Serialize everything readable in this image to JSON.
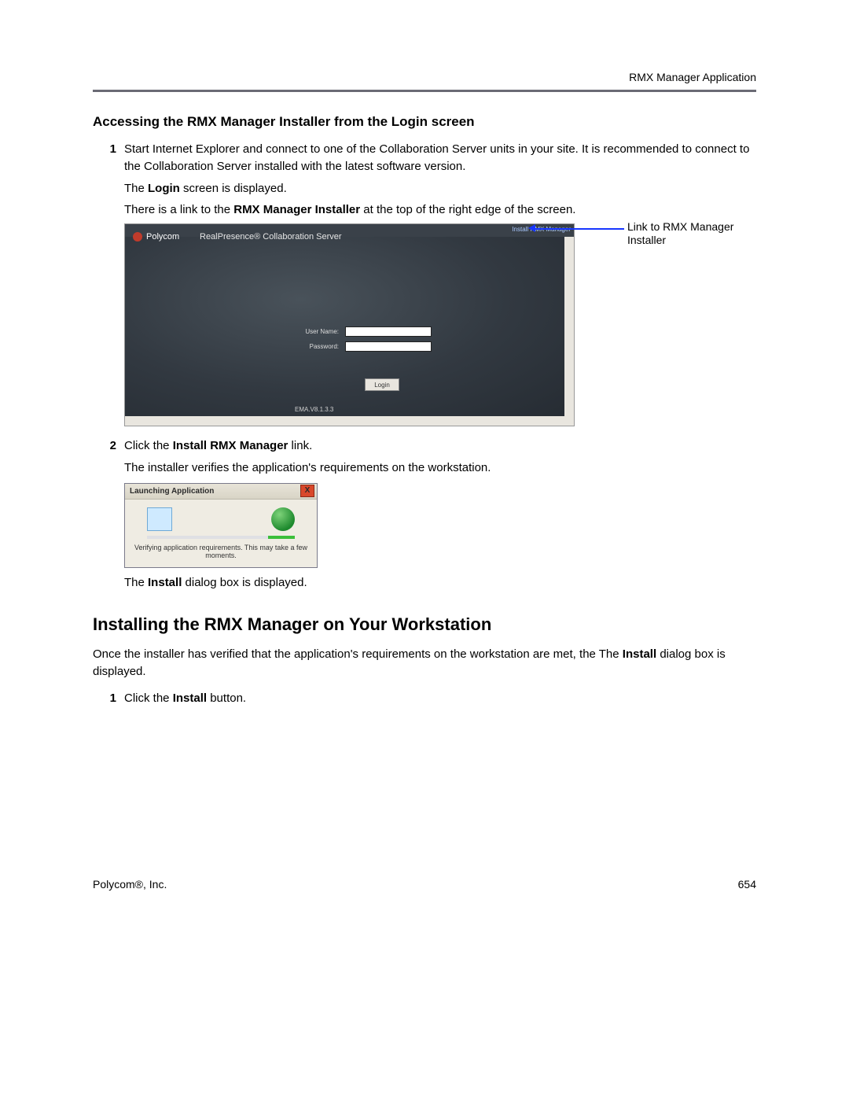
{
  "header": {
    "section": "RMX Manager Application"
  },
  "s1": {
    "title": "Accessing the RMX Manager Installer from the Login screen",
    "step1_num": "1",
    "step1a": "Start Internet Explorer and connect to one of the Collaboration Server units in your site. It is recommended to connect to the Collaboration Server installed with the latest software version.",
    "login_disp_a": "The ",
    "login_disp_b": "Login",
    "login_disp_c": " screen is displayed.",
    "link_a": "There is a link to the ",
    "link_b": "RMX Manager Installer",
    "link_c": " at the top of the right edge of the screen.",
    "step2_num": "2",
    "step2a": "Click the ",
    "step2b": "Install RMX Manager",
    "step2c": " link.",
    "verify": "The installer verifies the application's requirements on the workstation.",
    "install_disp_a": "The ",
    "install_disp_b": "Install",
    "install_disp_c": " dialog box is displayed."
  },
  "fig1": {
    "brand": "Polycom",
    "product": "RealPresence® Collaboration Server",
    "toplink": "Install RMX Manager",
    "user_lbl": "User Name:",
    "pass_lbl": "Password:",
    "login_btn": "Login",
    "version": "EMA.V8.1.3.3",
    "callout": "Link to RMX Manager Installer"
  },
  "fig2": {
    "title": "Launching Application",
    "close": "X",
    "msg": "Verifying application requirements. This may take a few moments."
  },
  "s2": {
    "title": "Installing the RMX Manager on Your Workstation",
    "intro_a": "Once the installer has verified that the application's requirements on the workstation are met, the The ",
    "intro_b": "Install",
    "intro_c": " dialog box is displayed.",
    "step1_num": "1",
    "step1a": "Click the ",
    "step1b": "Install",
    "step1c": " button."
  },
  "footer": {
    "left": "Polycom®, Inc.",
    "right": "654"
  }
}
